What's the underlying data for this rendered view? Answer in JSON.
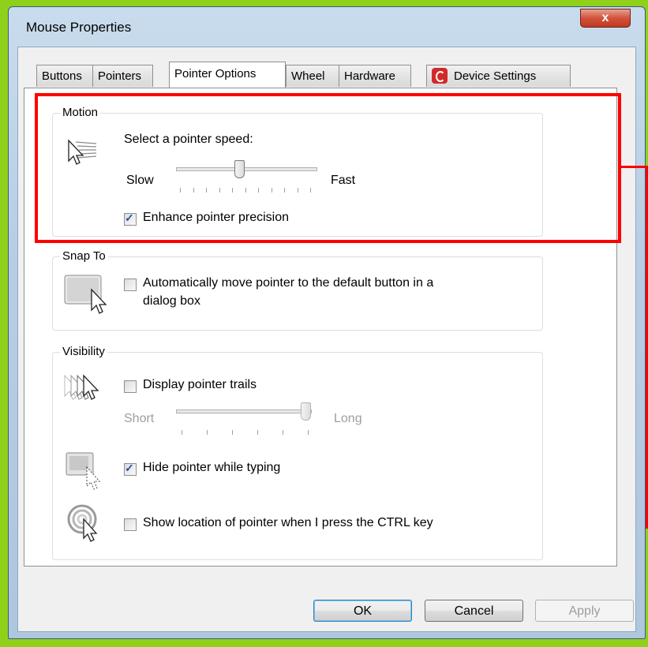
{
  "window": {
    "title": "Mouse Properties",
    "close_glyph": "x"
  },
  "tabs": [
    {
      "label": "Buttons"
    },
    {
      "label": "Pointers"
    },
    {
      "label": "Pointer Options"
    },
    {
      "label": "Wheel"
    },
    {
      "label": "Hardware"
    },
    {
      "label": "Device Settings",
      "icon": "device-settings-icon"
    }
  ],
  "motion": {
    "title": "Motion",
    "prompt": "Select a pointer speed:",
    "slow_label": "Slow",
    "fast_label": "Fast",
    "speed_fraction": 0.45,
    "enhance_label": "Enhance pointer precision",
    "enhance_checked": true
  },
  "snap": {
    "title": "Snap To",
    "label": "Automatically move pointer to the default button in a",
    "label_line2": "dialog box",
    "checked": false
  },
  "visibility": {
    "title": "Visibility",
    "trails_label": "Display pointer trails",
    "trails_checked": false,
    "short_label": "Short",
    "long_label": "Long",
    "trail_fraction": 1.0,
    "hide_label": "Hide pointer while typing",
    "hide_checked": true,
    "ctrl_label": "Show location of pointer when I press the CTRL key",
    "ctrl_checked": false
  },
  "buttons": {
    "ok": "OK",
    "cancel": "Cancel",
    "apply": "Apply"
  },
  "colors": {
    "background": "#8fd11a",
    "highlight": "#ff0000",
    "accent": "#3c7fb1"
  }
}
